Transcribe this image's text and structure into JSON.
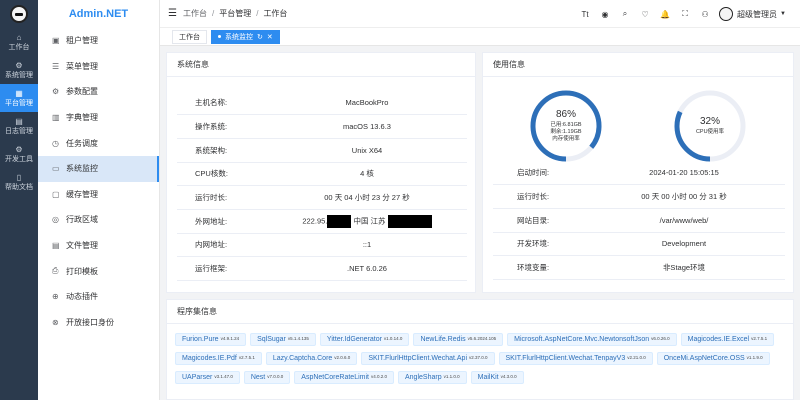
{
  "rail": [
    {
      "icon": "⌂",
      "label": "工作台",
      "active": false
    },
    {
      "icon": "⚙",
      "label": "系统管理",
      "active": false
    },
    {
      "icon": "▦",
      "label": "平台管理",
      "active": true
    },
    {
      "icon": "▤",
      "label": "日志管理",
      "active": false
    },
    {
      "icon": "⚙",
      "label": "开发工具",
      "active": false
    },
    {
      "icon": "▯",
      "label": "帮助文档",
      "active": false
    }
  ],
  "brand": "Admin.NET",
  "menu": [
    {
      "icon": "▣",
      "label": "租户管理"
    },
    {
      "icon": "☰",
      "label": "菜单管理"
    },
    {
      "icon": "⚙",
      "label": "参数配置"
    },
    {
      "icon": "▥",
      "label": "字典管理"
    },
    {
      "icon": "◷",
      "label": "任务调度"
    },
    {
      "icon": "▭",
      "label": "系统监控"
    },
    {
      "icon": "▢",
      "label": "缓存管理"
    },
    {
      "icon": "◎",
      "label": "行政区域"
    },
    {
      "icon": "▤",
      "label": "文件管理"
    },
    {
      "icon": "⎙",
      "label": "打印模板"
    },
    {
      "icon": "⊕",
      "label": "动态插件"
    },
    {
      "icon": "⊗",
      "label": "开放接口身份"
    }
  ],
  "breadcrumb": [
    "工作台",
    "平台管理",
    "工作台"
  ],
  "header_icons": [
    "Tt",
    "◉",
    "⌕",
    "♡",
    "🔔",
    "⛶",
    "⚇"
  ],
  "user": "超级管理员",
  "tabs": [
    {
      "label": "工作台",
      "active": false
    },
    {
      "label": "系统监控",
      "active": true
    }
  ],
  "system_info": {
    "title": "系统信息",
    "rows": [
      {
        "k": "主机名称:",
        "v": "MacBookPro"
      },
      {
        "k": "操作系统:",
        "v": "macOS 13.6.3"
      },
      {
        "k": "系统架构:",
        "v": "Unix X64"
      },
      {
        "k": "CPU核数:",
        "v": "4 核"
      },
      {
        "k": "运行时长:",
        "v": "00 天 04 小时 23 分 27 秒"
      },
      {
        "k": "外网地址:",
        "v": "222.95.",
        "v2": "中国 江苏"
      },
      {
        "k": "内网地址:",
        "v": "::1"
      },
      {
        "k": "运行框架:",
        "v": ".NET 6.0.26"
      }
    ]
  },
  "usage_info": {
    "title": "使用信息",
    "memory": {
      "percent": "86%",
      "used": "已用:6.81GB",
      "free": "剩余:1.19GB",
      "label": "内存使用率",
      "value": 0.86
    },
    "cpu": {
      "percent": "32%",
      "label": "CPU使用率",
      "value": 0.32
    },
    "rows": [
      {
        "k": "启动时间:",
        "v": "2024-01-20 15:05:15"
      },
      {
        "k": "运行时长:",
        "v": "00 天 00 小时 00 分 31 秒"
      },
      {
        "k": "网站目录:",
        "v": "/var/www/web/"
      },
      {
        "k": "开发环境:",
        "v": "Development"
      },
      {
        "k": "环境变量:",
        "v": "非Stage环境"
      }
    ]
  },
  "assembly_info": {
    "title": "程序集信息",
    "packages": [
      {
        "name": "Furion.Pure",
        "ver": "v4.9.1.24"
      },
      {
        "name": "SqlSugar",
        "ver": "v5.1.4.135"
      },
      {
        "name": "Yitter.IdGenerator",
        "ver": "v1.0.14.0"
      },
      {
        "name": "NewLife.Redis",
        "ver": "v5.6.2024.105"
      },
      {
        "name": "Microsoft.AspNetCore.Mvc.NewtonsoftJson",
        "ver": "v6.0.26.0"
      },
      {
        "name": "Magicodes.IE.Excel",
        "ver": "v2.7.5.1"
      },
      {
        "name": "Magicodes.IE.Pdf",
        "ver": "v2.7.5.1"
      },
      {
        "name": "Lazy.Captcha.Core",
        "ver": "v2.0.6.0"
      },
      {
        "name": "SKIT.FlurlHttpClient.Wechat.Api",
        "ver": "v2.37.0.0"
      },
      {
        "name": "SKIT.FlurlHttpClient.Wechat.TenpayV3",
        "ver": "v2.21.0.0"
      },
      {
        "name": "OnceMi.AspNetCore.OSS",
        "ver": "v1.1.9.0"
      },
      {
        "name": "UAParser",
        "ver": "v3.1.47.0"
      },
      {
        "name": "Nest",
        "ver": "v7.0.0.0"
      },
      {
        "name": "AspNetCoreRateLimit",
        "ver": "v4.0.2.0"
      },
      {
        "name": "AngleSharp",
        "ver": "v1.1.0.0"
      },
      {
        "name": "MailKit",
        "ver": "v4.3.0.0"
      }
    ]
  },
  "colors": {
    "accent": "#2d8cf0",
    "rail_bg": "#2b3a4d"
  }
}
